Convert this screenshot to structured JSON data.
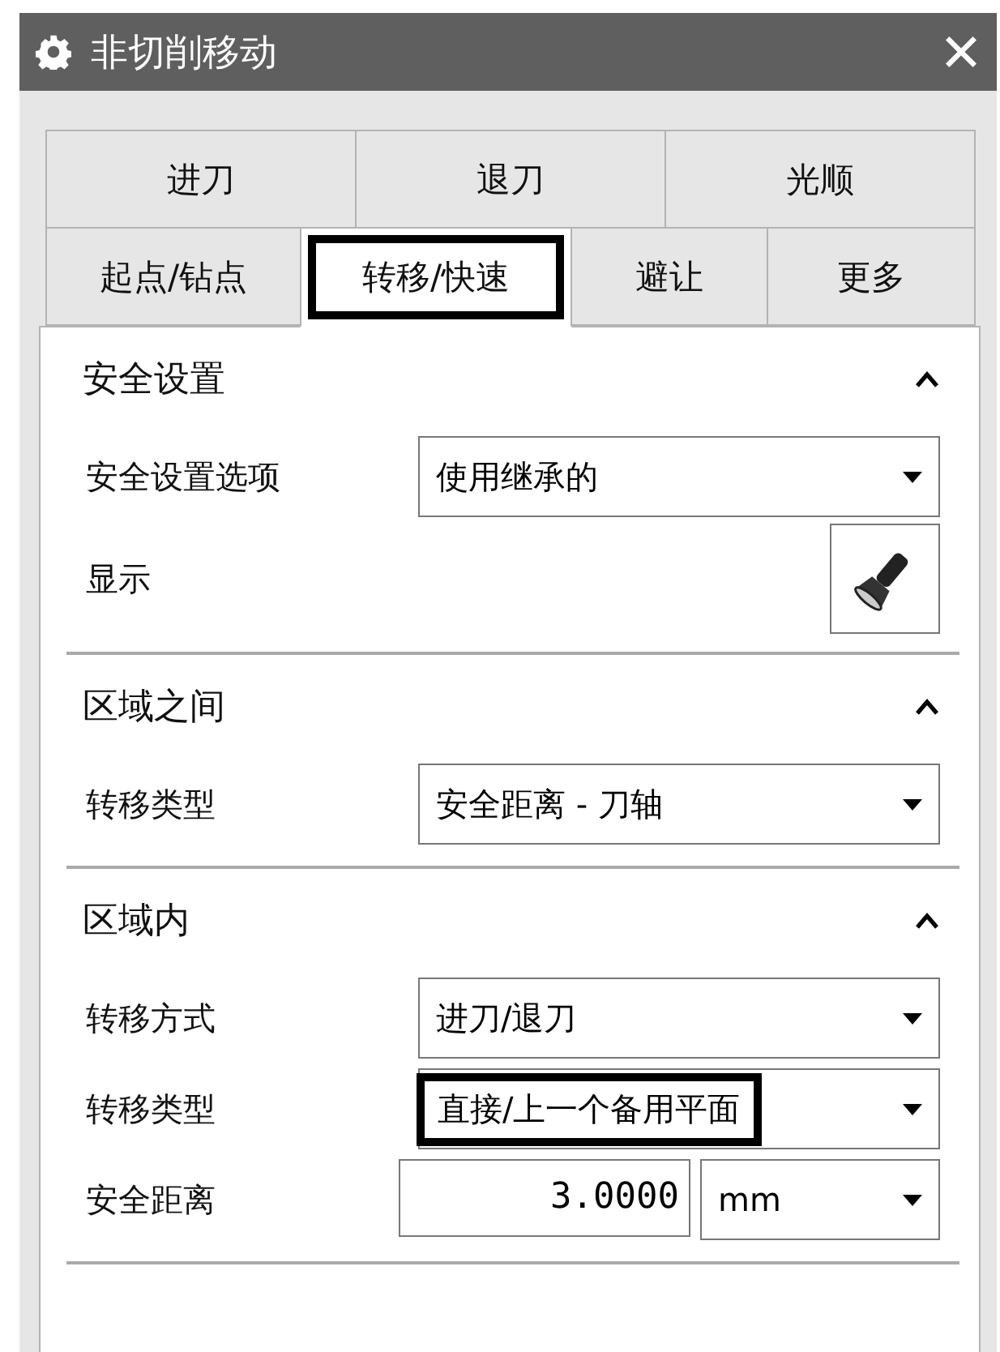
{
  "window": {
    "title": "非切削移动"
  },
  "tab_rows": [
    {
      "tabs": [
        {
          "label": "进刀",
          "selected": false,
          "highlighted": false
        },
        {
          "label": "退刀",
          "selected": false,
          "highlighted": false
        },
        {
          "label": "光顺",
          "selected": false,
          "highlighted": false
        }
      ]
    },
    {
      "tabs": [
        {
          "label": "起点/钻点",
          "selected": false,
          "highlighted": false
        },
        {
          "label": "转移/快速",
          "selected": true,
          "highlighted": true
        },
        {
          "label": "避让",
          "selected": false,
          "highlighted": false
        },
        {
          "label": "更多",
          "selected": false,
          "highlighted": false
        }
      ]
    }
  ],
  "sections": [
    {
      "title": "安全设置",
      "expanded": true,
      "rows": [
        {
          "kind": "dropdown",
          "label": "安全设置选项",
          "value": "使用继承的",
          "highlighted": false
        },
        {
          "kind": "icon_button",
          "label": "显示"
        }
      ]
    },
    {
      "title": "区域之间",
      "expanded": true,
      "rows": [
        {
          "kind": "dropdown",
          "label": "转移类型",
          "value": "安全距离 - 刀轴",
          "highlighted": false
        }
      ]
    },
    {
      "title": "区域内",
      "expanded": true,
      "rows": [
        {
          "kind": "dropdown",
          "label": "转移方式",
          "value": "进刀/退刀",
          "highlighted": false
        },
        {
          "kind": "dropdown",
          "label": "转移类型",
          "value": "直接/上一个备用平面",
          "highlighted": true
        },
        {
          "kind": "number_unit",
          "label": "安全距离",
          "value": "3.0000",
          "unit": "mm"
        }
      ]
    }
  ]
}
